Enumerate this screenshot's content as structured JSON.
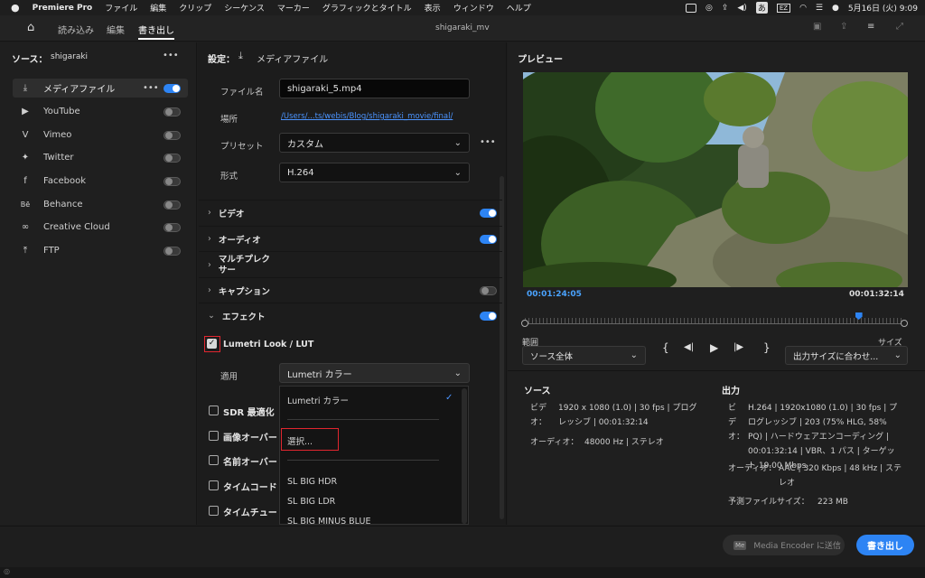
{
  "menubar": {
    "apple": "",
    "app": "Premiere Pro",
    "items": [
      "ファイル",
      "編集",
      "クリップ",
      "シーケンス",
      "マーカー",
      "グラフィックとタイトル",
      "表示",
      "ウィンドウ",
      "ヘルプ"
    ],
    "ime": "あ",
    "battery": "EZ",
    "datetime": "5月16日 (火) 9:09"
  },
  "header": {
    "tabs": [
      "読み込み",
      "編集",
      "書き出し"
    ],
    "active_tab": "書き出し",
    "project_title": "shigaraki_mv"
  },
  "source": {
    "label": "ソース：",
    "name": "shigaraki",
    "more": "•••",
    "items": [
      {
        "label": "メディアファイル",
        "on": true
      },
      {
        "label": "YouTube",
        "on": false
      },
      {
        "label": "Vimeo",
        "on": false
      },
      {
        "label": "Twitter",
        "on": false
      },
      {
        "label": "Facebook",
        "on": false
      },
      {
        "label": "Behance",
        "on": false
      },
      {
        "label": "Creative Cloud",
        "on": false
      },
      {
        "label": "FTP",
        "on": false
      }
    ]
  },
  "settings": {
    "title": "設定：",
    "target": "メディアファイル",
    "filename_label": "ファイル名",
    "filename": "shigaraki_5.mp4",
    "location_label": "場所",
    "location": "/Users/...ts/webis/Blog/shigaraki_movie/final/",
    "preset_label": "プリセット",
    "preset": "カスタム",
    "format_label": "形式",
    "format": "H.264",
    "sections": [
      {
        "label": "ビデオ",
        "on": true
      },
      {
        "label": "オーディオ",
        "on": true
      },
      {
        "label": "マルチプレクサー",
        "on": null
      },
      {
        "label": "キャプション",
        "on": false
      },
      {
        "label": "エフェクト",
        "on": true
      }
    ],
    "lumetri_label": "Lumetri Look / LUT",
    "apply_label": "適用",
    "apply_value": "Lumetri カラー",
    "effect_rows": [
      "SDR 最適化",
      "画像オーバー",
      "名前オーバー",
      "タイムコード",
      "タイムチュー"
    ],
    "dropdown": {
      "options": [
        "Lumetri カラー",
        "選択...",
        "SL BIG HDR",
        "SL BIG LDR",
        "SL BIG MINUS BLUE"
      ],
      "selected": "Lumetri カラー"
    }
  },
  "preview": {
    "title": "プレビュー",
    "timecode_current": "00:01:24:05",
    "timecode_total": "00:01:32:14",
    "playhead_progress": 0.88,
    "range_label": "範囲",
    "range_value": "ソース全体",
    "size_label": "サイズ",
    "size_value": "出力サイズに合わせ...",
    "controls": [
      "{",
      "◀|",
      "▶",
      "|▶",
      "}"
    ]
  },
  "source_info": {
    "title": "ソース",
    "video_label": "ビデ\nオ：",
    "video": "1920 x 1080 (1.0) | 30 fps | プログレッシブ | 00:01:32:14",
    "audio_label": "オーディオ：",
    "audio": "48000 Hz | ステレオ"
  },
  "output_info": {
    "title": "出力",
    "video_label": "ビ\nデ\nオ：",
    "video": "H.264 | 1920x1080 (1.0) | 30 fps | プログレッシブ | 203 (75% HLG, 58% PQ) | ハードウェアエンコーディング | 00:01:32:14 | VBR、1 パス | ターゲット 19.00 Mbps",
    "audio_label": "オーディオ：",
    "audio": "AAC | 320 Kbps | 48 kHz | ステレオ",
    "filesize_label": "予測ファイルサイズ：",
    "filesize": "223 MB"
  },
  "footer": {
    "media_encoder": "Media Encoder に送信",
    "me_badge": "Me",
    "export": "書き出し"
  },
  "colors": {
    "accent": "#2d84f4",
    "highlight": "#e0262f",
    "timecode": "#4aa3ff"
  }
}
